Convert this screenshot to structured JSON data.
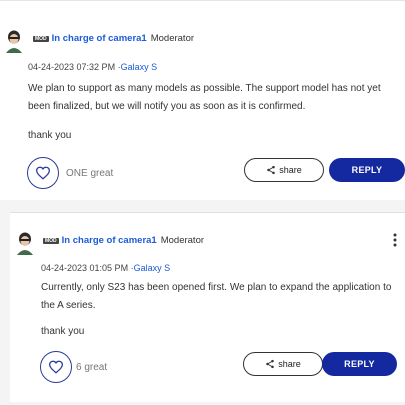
{
  "posts": [
    {
      "mod_tag": "MOD",
      "author": "In charge of camera1",
      "role": "Moderator",
      "timestamp": "04-24-2023 07:32 PM",
      "separator": "·",
      "device": "Galaxy S",
      "body": "We plan to support as many models as possible. The support model has not yet been finalized, but we will notify you as soon as it is confirmed.",
      "closing": "thank you",
      "likes": "ONE great",
      "share_label": "share",
      "reply_label": "REPLY"
    },
    {
      "mod_tag": "MOD",
      "author": "In charge of camera1",
      "role": "Moderator",
      "timestamp": "04-24-2023 01:05 PM",
      "separator": "·",
      "device": "Galaxy S",
      "body": "Currently, only S23 has been opened first. We plan to expand the application to the A series.",
      "closing": "thank you",
      "likes": "6 great",
      "share_label": "share",
      "reply_label": "REPLY"
    }
  ],
  "colors": {
    "accent": "#1428a0",
    "link": "#1c5bd8",
    "heart_outline": "#2b3a9b"
  },
  "icons": [
    "avatar",
    "heart-icon",
    "share-icon",
    "more-vertical-icon"
  ]
}
